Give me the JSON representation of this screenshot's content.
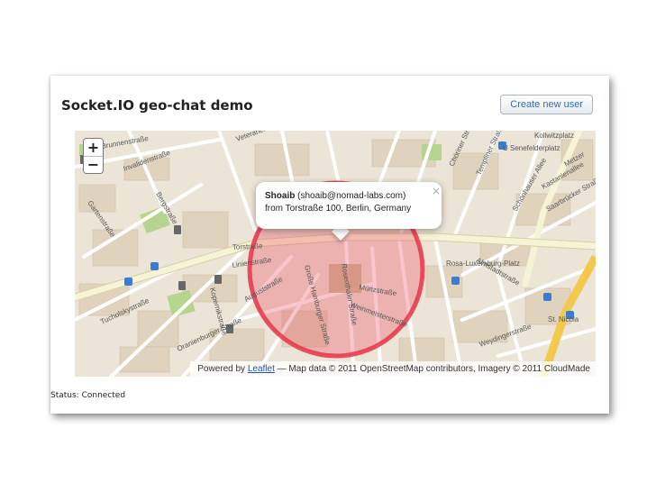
{
  "app": {
    "title": "Socket.IO geo-chat demo",
    "create_button_label": "Create new user"
  },
  "map": {
    "zoom_in_label": "+",
    "zoom_out_label": "−",
    "accent_circle_color": "#e8334a",
    "street_labels": [
      "Veteranenstraße",
      "Brunnenstraße",
      "Invalidenstraße",
      "Bergstraße",
      "Gartenstraße",
      "Torstraße",
      "Linienstraße",
      "Auguststraße",
      "Große Hamburger Straße",
      "Rosenthaler Straße",
      "Weinmeisterstraße",
      "Choriner Straße",
      "Templiner Straße",
      "Schönhauser Allee",
      "Saarbrücker Straße",
      "Kastanienallee",
      "Rosa-Luxemburg-Platz",
      "Münzstraße",
      "Almstadtstraße",
      "Weydingerstraße",
      "St. Nicola",
      "U Senefelderplatz",
      "Kollwitzplatz",
      "Metzer",
      "Kopernikstraße",
      "Oranienburger Straße",
      "Tucholskystraße"
    ],
    "popup": {
      "name": "Shoaib",
      "email": "(shoaib@nomad-labs.com)",
      "location": "from Torstraße 100, Berlin, Germany",
      "close_label": "×"
    },
    "attribution": {
      "prefix": "Powered by",
      "link_text": "Leaflet",
      "suffix": "— Map data © 2011 OpenStreetMap contributors, Imagery © 2011 CloudMade"
    }
  },
  "status": {
    "text": "Status: Connected"
  }
}
